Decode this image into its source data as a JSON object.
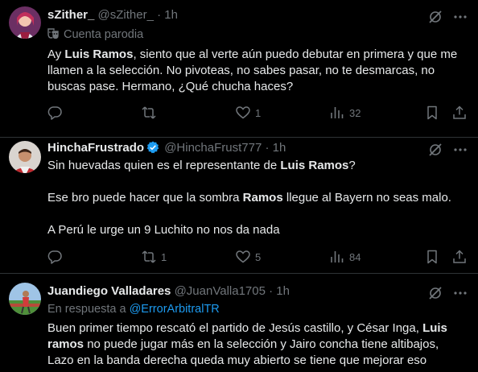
{
  "tweets": [
    {
      "display_name": "sZither_",
      "handle": "@sZither_",
      "sep": "·",
      "time": "1h",
      "label_icon": "parody-mask-icon",
      "label": "Cuenta parodia",
      "body_parts": [
        "Ay ",
        "Luis Ramos",
        ", siento que al verte aún puedo debutar en primera y que me llamen a la selección. No pivoteas, no sabes pasar, no te desmarcas, no buscas pase. Hermano, ¿Qué chucha haces?"
      ],
      "replies": "",
      "retweets": "",
      "likes": "1",
      "views": "32"
    },
    {
      "display_name": "HinchaFrustrado",
      "verified": true,
      "handle": "@HinchaFrust777",
      "sep": "·",
      "time": "1h",
      "paragraphs": [
        [
          "Sin huevadas quien es el representante de ",
          "Luis Ramos",
          "?"
        ],
        [
          "Ese bro puede hacer que la sombra ",
          "Ramos",
          " llegue al Bayern no seas malo."
        ],
        [
          "A Perú le urge un 9 Luchito no nos da nada"
        ]
      ],
      "replies": "",
      "retweets": "1",
      "likes": "5",
      "views": "84"
    },
    {
      "display_name": "Juandiego Valladares",
      "handle": "@JuanValla1705",
      "sep": "·",
      "time": "1h",
      "reply_prefix": "En respuesta a ",
      "reply_to": "@ErrorArbitralTR",
      "body_parts": [
        "Buen primer tiempo rescató el partido de Jesús castillo, y César Inga, ",
        "Luis ramos",
        " no puede jugar más en la selección y Jairo concha tiene altibajos, Lazo en la banda derecha queda muy abierto se tiene que mejorar eso"
      ]
    }
  ],
  "colors": {
    "background": "#000000",
    "text": "#e7e9ea",
    "muted": "#71767b",
    "link": "#1d9bf0",
    "divider": "#2f3336"
  }
}
